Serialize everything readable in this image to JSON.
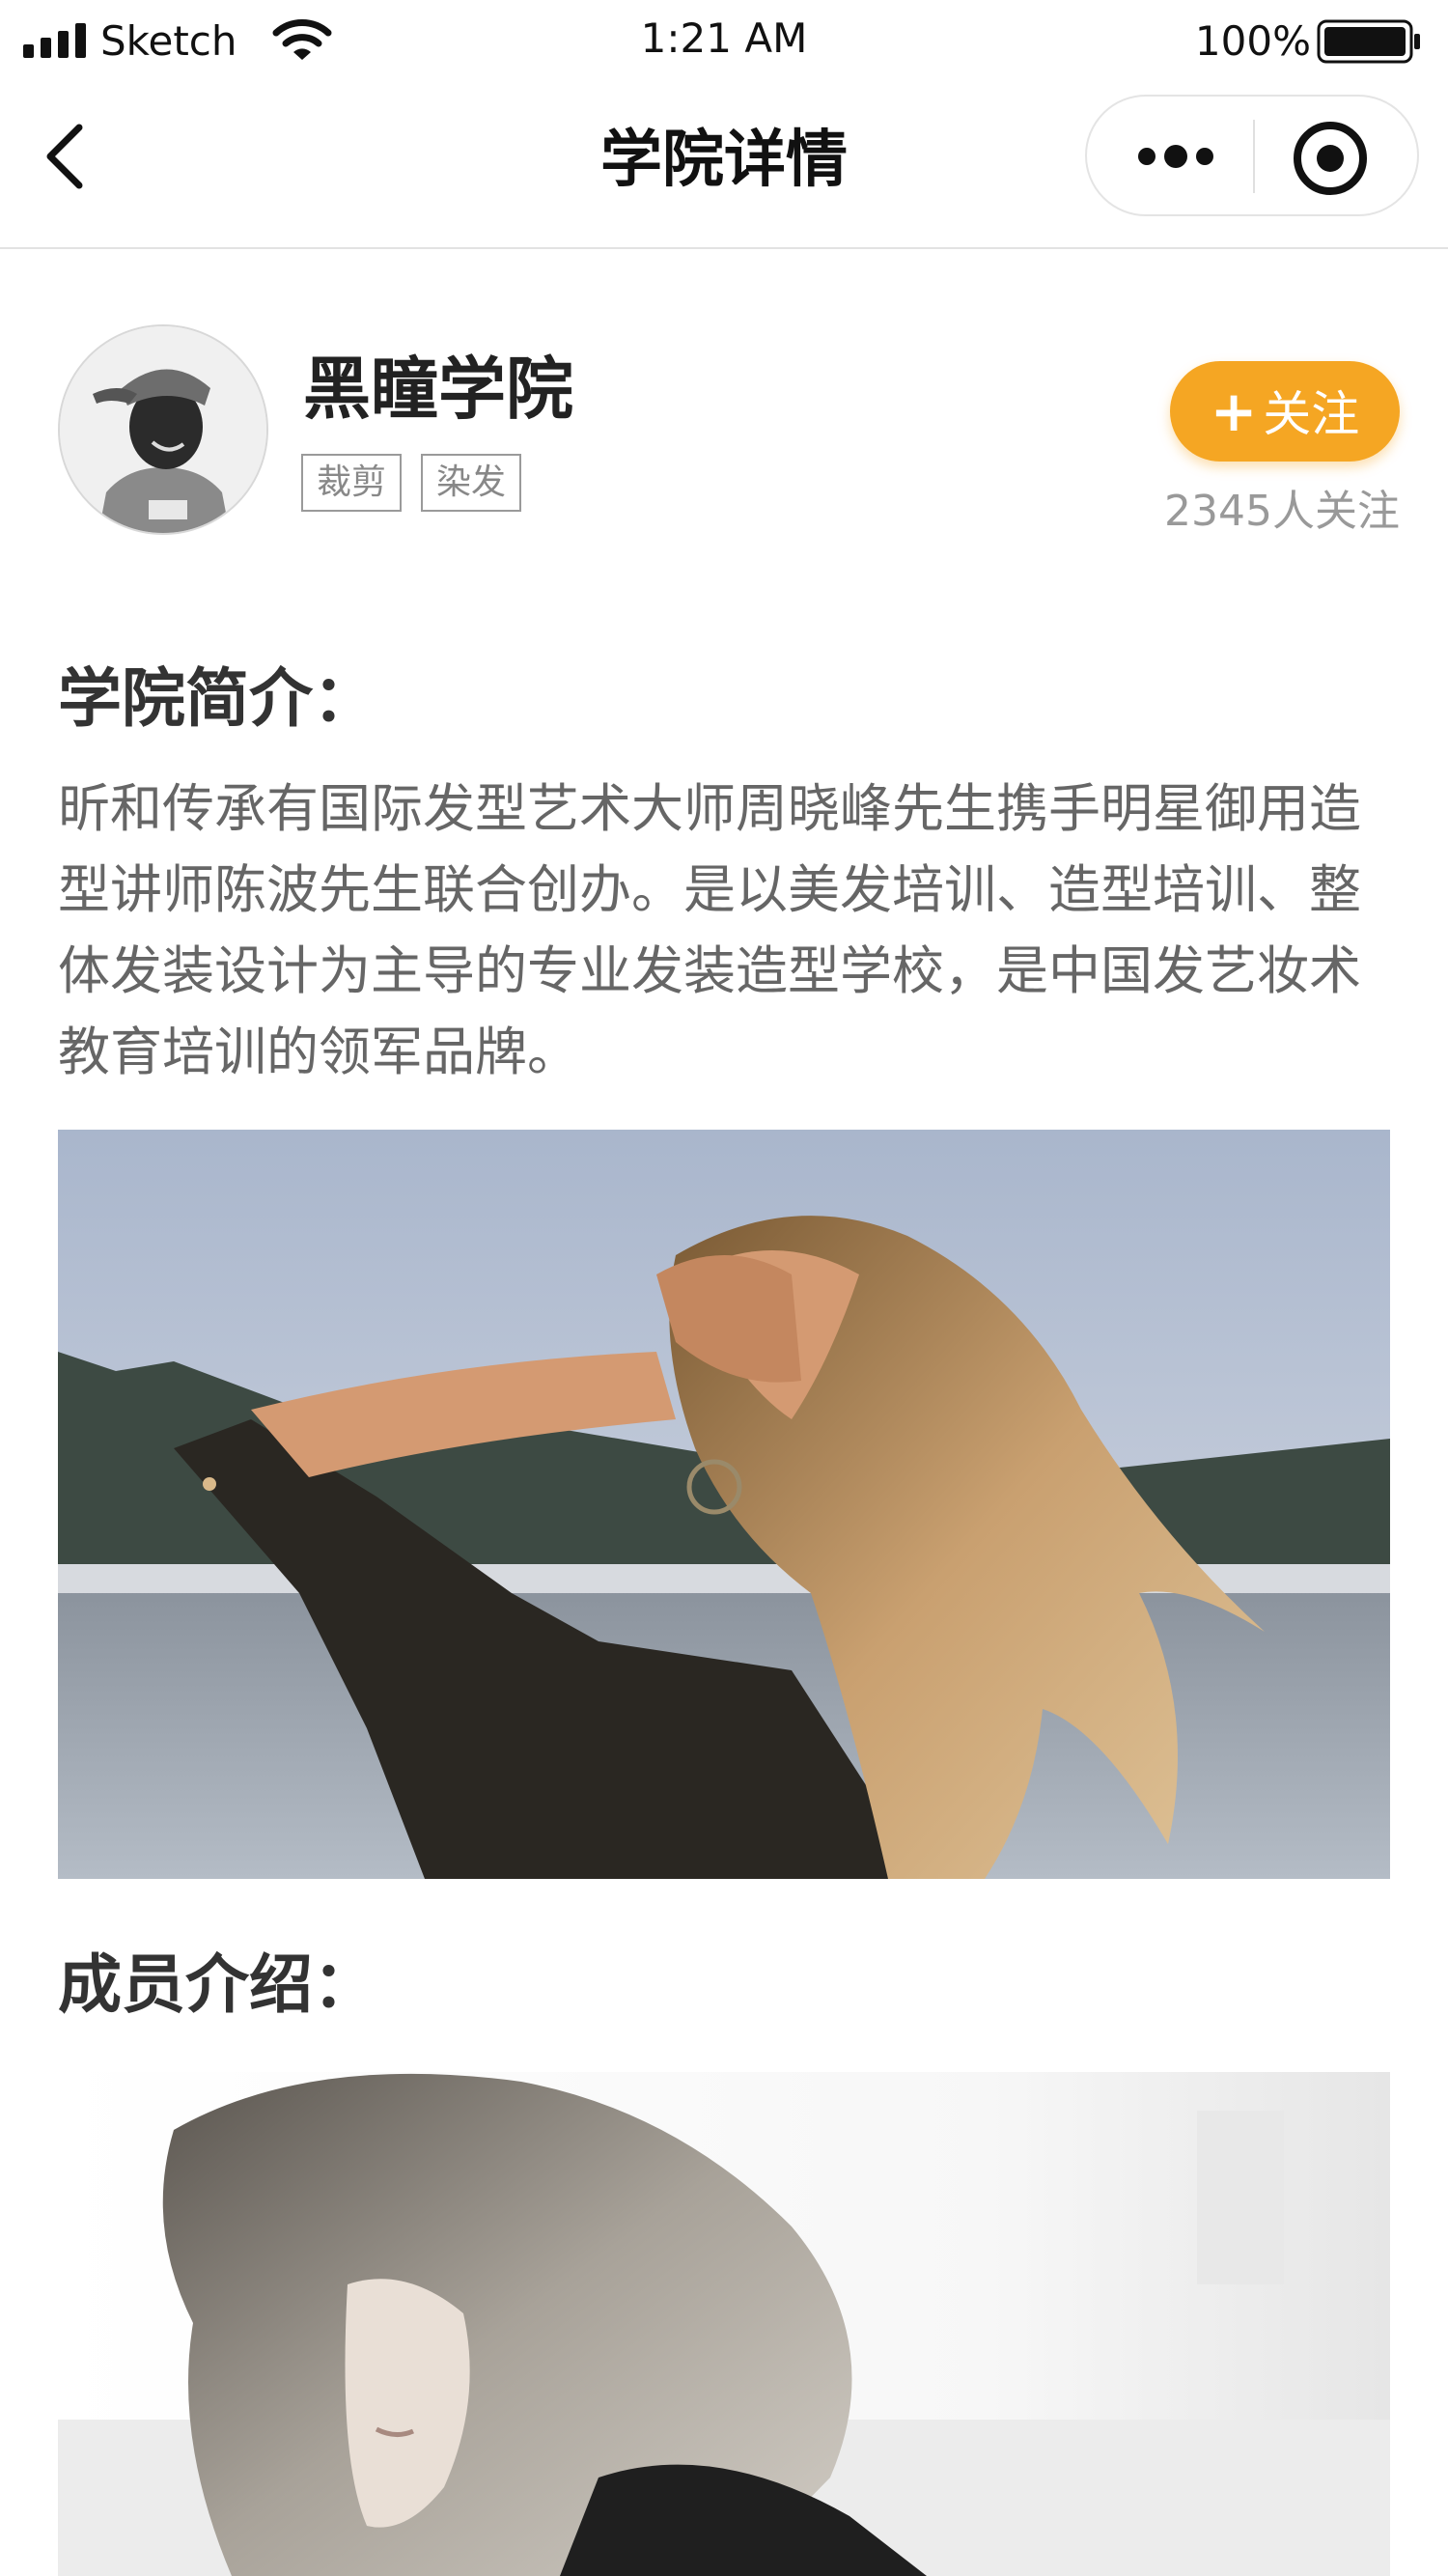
{
  "status_bar": {
    "carrier": "Sketch",
    "time": "1:21 AM",
    "battery_percent": "100%",
    "icons": [
      "signal-icon",
      "wifi-icon",
      "battery-icon"
    ]
  },
  "nav": {
    "title": "学院详情",
    "icons": [
      "chevron-left-icon",
      "more-dots-icon",
      "target-circle-icon"
    ]
  },
  "profile": {
    "name": "黑瞳学院",
    "tags": [
      "裁剪",
      "染发"
    ],
    "follow_plus": "+",
    "follow_label": "关注",
    "follow_count": "2345人关注"
  },
  "intro": {
    "title": "学院简介：",
    "text": "昕和传承有国际发型艺术大师周晓峰先生携手明星御用造型讲师陈波先生联合创办。是以美发培训、造型培训、整体发装设计为主导的专业发装造型学校，是中国发艺妆术教育培训的领军品牌。"
  },
  "members": {
    "title": "成员介绍："
  },
  "colors": {
    "accent": "#f5a623",
    "title_text": "#333333",
    "body_text": "#666666",
    "muted_text": "#999999"
  }
}
